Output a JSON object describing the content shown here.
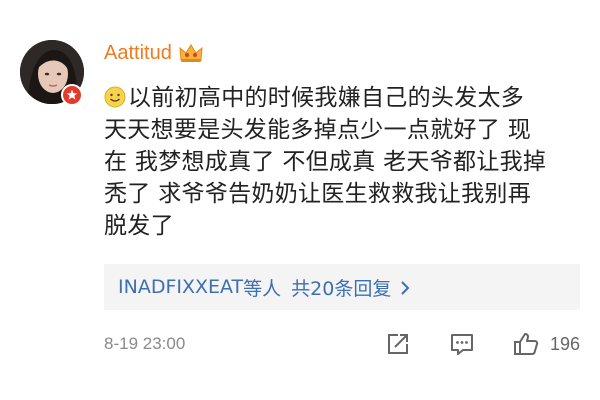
{
  "post": {
    "username": "Aattitud",
    "emoji_icon": "smile-emoji-icon",
    "comment_lines": [
      "以前初高中的时候我嫌自己的头发太多",
      "天天想要是头发能多掉点少一点就好了 现",
      "在 我梦想成真了 不但成真 老天爷都让我掉",
      "秃了 求爷爷告奶奶让医生救救我让我别再",
      "脱发了"
    ],
    "replies": {
      "users": "INADFIXXEAT",
      "users_suffix": "等人",
      "count_text": "共20条回复"
    },
    "timestamp": "8-19 23:00",
    "like_count": "196"
  },
  "colors": {
    "username": "#ef7a1f",
    "link": "#3d6fb3",
    "badge": "#e33a2b",
    "meta": "#8a8a8a"
  }
}
